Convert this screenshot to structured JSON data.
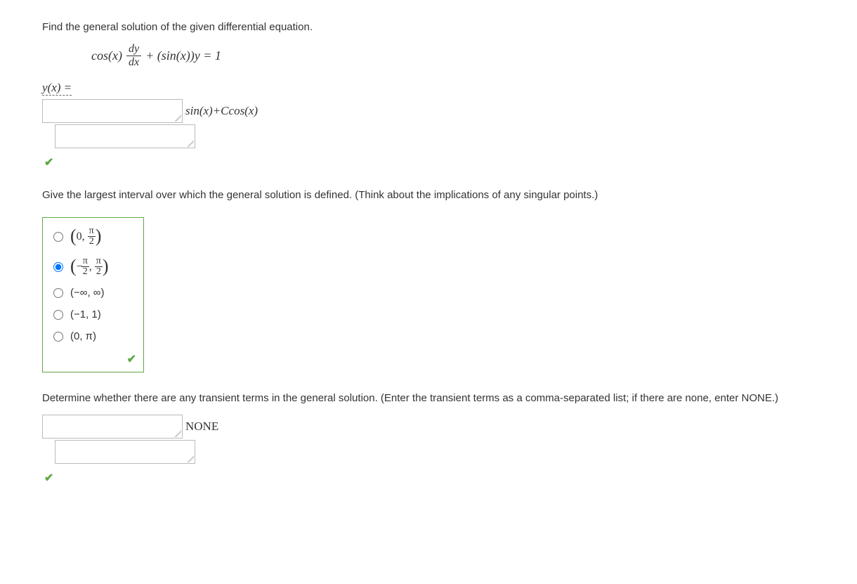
{
  "q1": {
    "prompt": "Find the general solution of the given differential equation.",
    "eq": {
      "cos": "cos(x)",
      "dy": "dy",
      "dx": "dx",
      "plus": "+ (sin(x))y = 1"
    },
    "yx": "y(x) =",
    "answer": "sin(x)+Ccos(x)"
  },
  "q2": {
    "prompt": "Give the largest interval over which the general solution is defined. (Think about the implications of any singular points.)",
    "options": {
      "opt1": {
        "left": "0",
        "commaOmit": true,
        "right_num": "π",
        "right_den": "2"
      },
      "opt2": {
        "left_num": "π",
        "left_den": "2",
        "neg_left": true,
        "comma": ",",
        "right_num": "π",
        "right_den": "2"
      },
      "opt3": "(−∞, ∞)",
      "opt4": "(−1, 1)",
      "opt5": "(0, π)"
    },
    "selected": "opt2"
  },
  "q3": {
    "prompt": "Determine whether there are any transient terms in the general solution. (Enter the transient terms as a comma-separated list; if there are none, enter NONE.)",
    "answer": "NONE"
  }
}
